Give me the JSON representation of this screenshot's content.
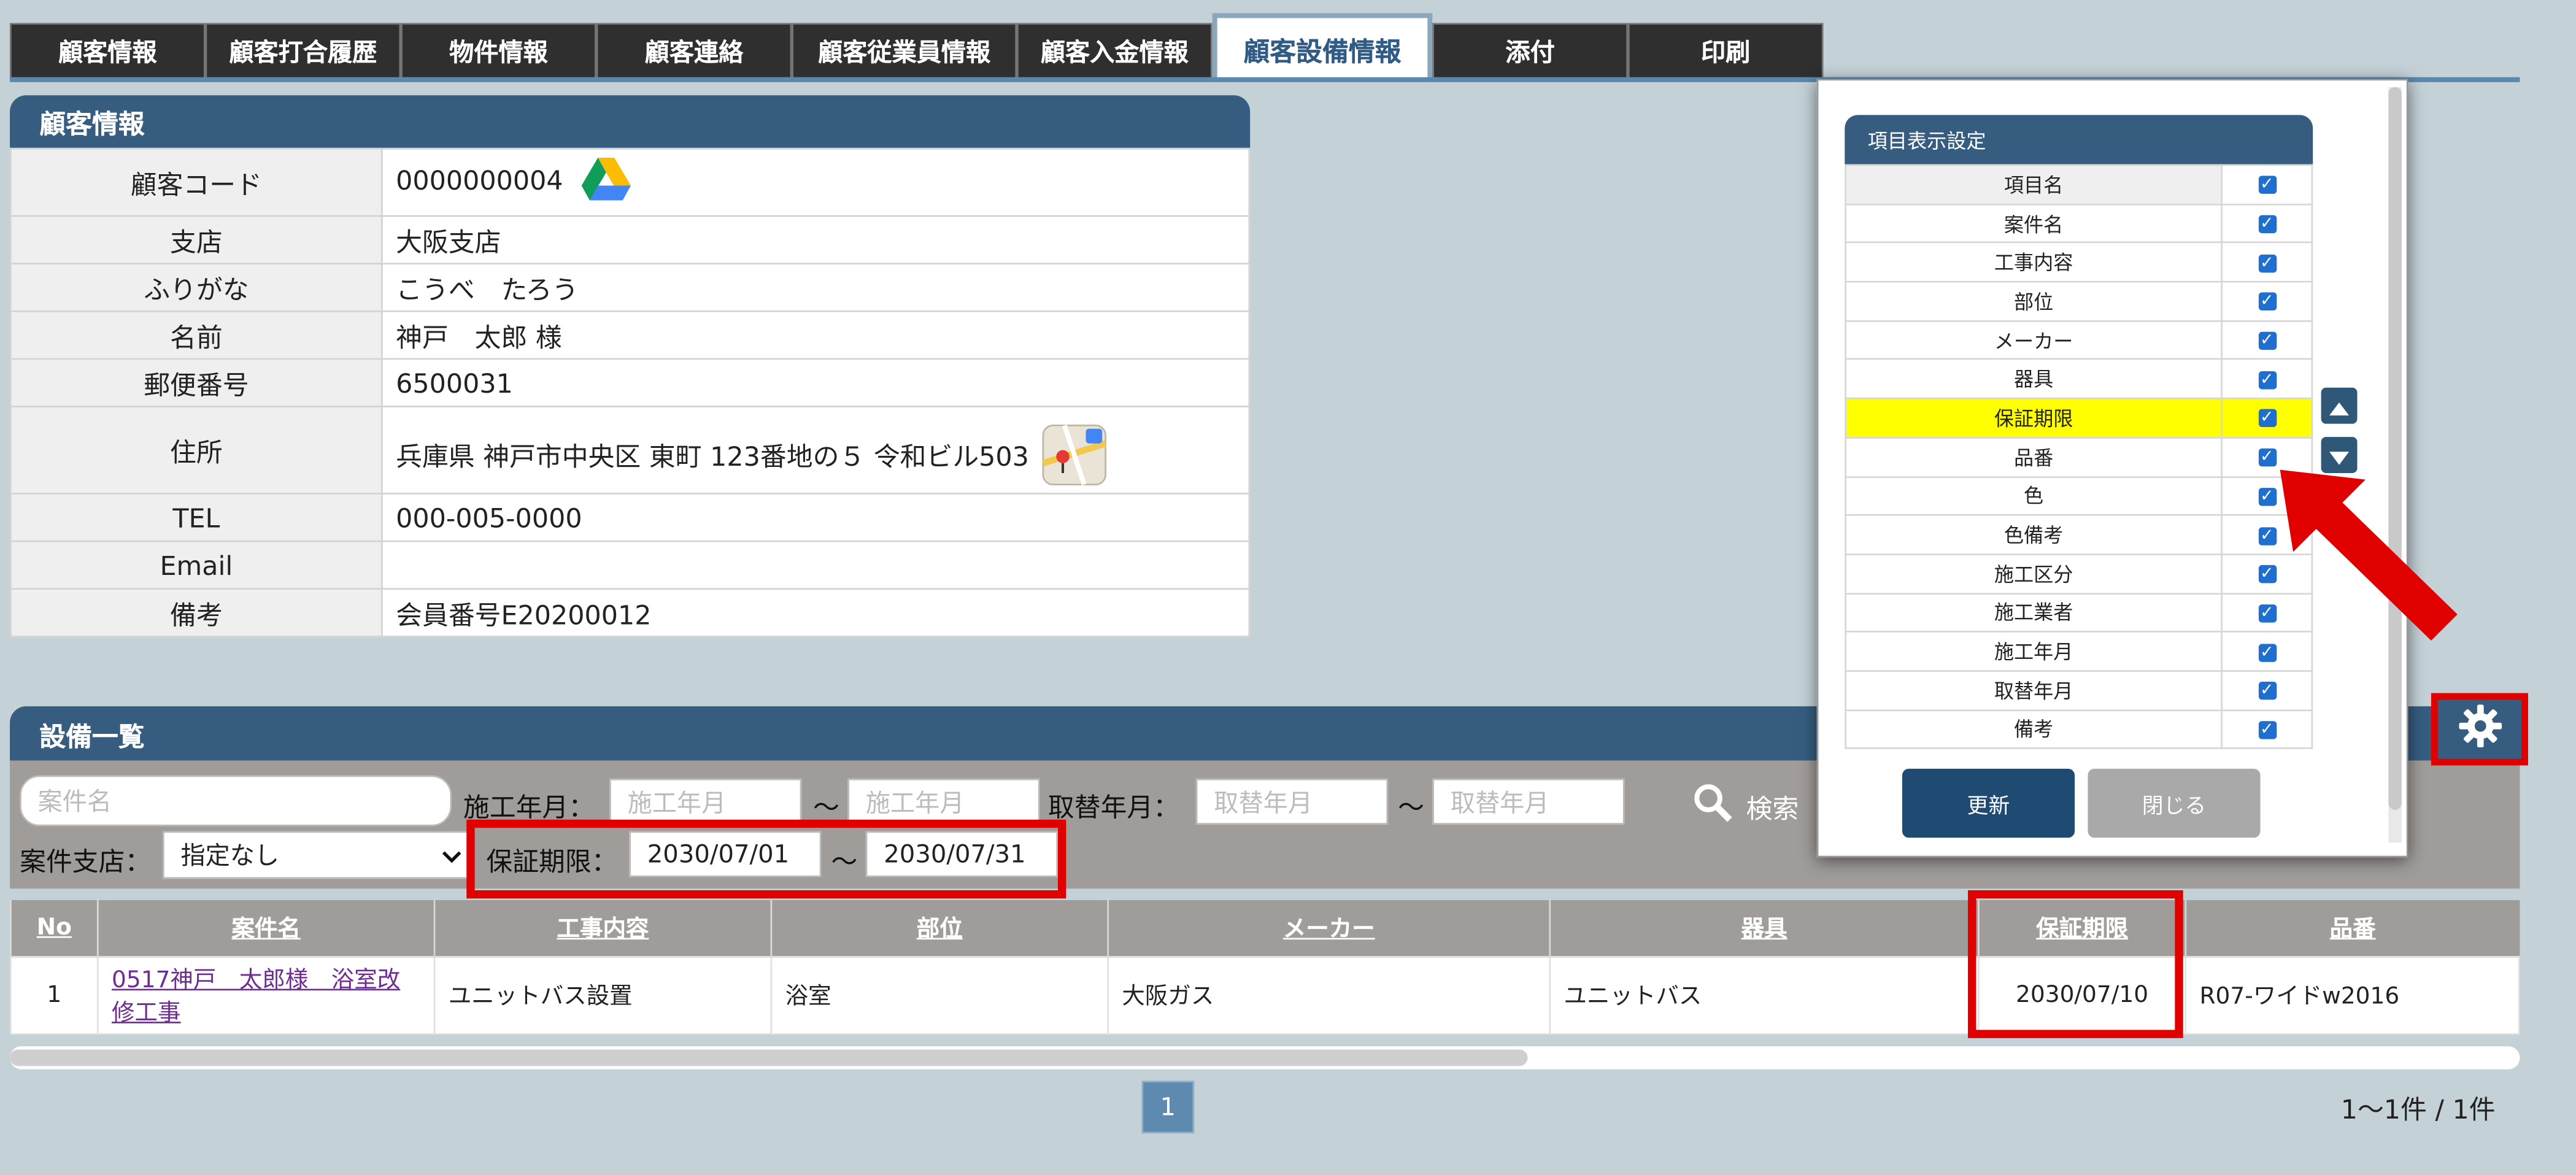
{
  "tabs": [
    {
      "label": "顧客情報"
    },
    {
      "label": "顧客打合履歴"
    },
    {
      "label": "物件情報"
    },
    {
      "label": "顧客連絡"
    },
    {
      "label": "顧客従業員情報"
    },
    {
      "label": "顧客入金情報"
    },
    {
      "label": "顧客設備情報",
      "active": true
    },
    {
      "label": "添付"
    },
    {
      "label": "印刷"
    }
  ],
  "customer": {
    "title": "顧客情報",
    "rows": [
      {
        "label": "顧客コード",
        "value": "0000000004"
      },
      {
        "label": "支店",
        "value": "大阪支店"
      },
      {
        "label": "ふりがな",
        "value": "こうべ　たろう"
      },
      {
        "label": "名前",
        "value": "神戸　太郎 様"
      },
      {
        "label": "郵便番号",
        "value": "6500031"
      },
      {
        "label": "住所",
        "value": "兵庫県 神戸市中央区 東町 123番地の５ 令和ビル503"
      },
      {
        "label": "TEL",
        "value": "000-005-0000"
      },
      {
        "label": "Email",
        "value": ""
      },
      {
        "label": "備考",
        "value": "会員番号E20200012"
      }
    ],
    "icons": {
      "code": "google-drive-icon",
      "address": "map-icon"
    }
  },
  "equipment": {
    "title": "設備一覧",
    "search": {
      "case_name_placeholder": "案件名",
      "construction_label": "施工年月：",
      "construction_from_placeholder": "施工年月",
      "construction_to_placeholder": "施工年月",
      "replace_label": "取替年月：",
      "replace_from_placeholder": "取替年月",
      "replace_to_placeholder": "取替年月",
      "tilde": "～",
      "search_label": "検索",
      "branch_label": "案件支店：",
      "branch_value": "指定なし",
      "warranty_label": "保証期限：",
      "warranty_from": "2030/07/01",
      "warranty_to": "2030/07/31"
    },
    "columns": [
      "No",
      "案件名",
      "工事内容",
      "部位",
      "メーカー",
      "器具",
      "保証期限",
      "品番"
    ],
    "rows": [
      {
        "no": "1",
        "case": "0517神戸　太郎様　浴室改修工事",
        "work": "ユニットバス設置",
        "part": "浴室",
        "maker": "大阪ガス",
        "fixture": "ユニットバス",
        "warranty": "2030/07/10",
        "product": "R07-ワイドw2016"
      }
    ],
    "pagination": {
      "current": "1",
      "summary": "1～1件 / 1件"
    }
  },
  "column_settings": {
    "title": "項目表示設定",
    "items": [
      {
        "label": "項目名",
        "checked": true
      },
      {
        "label": "案件名",
        "checked": true
      },
      {
        "label": "工事内容",
        "checked": true
      },
      {
        "label": "部位",
        "checked": true
      },
      {
        "label": "メーカー",
        "checked": true
      },
      {
        "label": "器具",
        "checked": true
      },
      {
        "label": "保証期限",
        "checked": true,
        "highlighted": true
      },
      {
        "label": "品番",
        "checked": true
      },
      {
        "label": "色",
        "checked": true
      },
      {
        "label": "色備考",
        "checked": true
      },
      {
        "label": "施工区分",
        "checked": true
      },
      {
        "label": "施工業者",
        "checked": true
      },
      {
        "label": "施工年月",
        "checked": true
      },
      {
        "label": "取替年月",
        "checked": true
      },
      {
        "label": "備考",
        "checked": true
      }
    ],
    "update_label": "更新",
    "close_label": "閉じる"
  },
  "colors": {
    "accent": "#365d80",
    "highlight": "#ffff00",
    "annotation_red": "#e10000"
  }
}
